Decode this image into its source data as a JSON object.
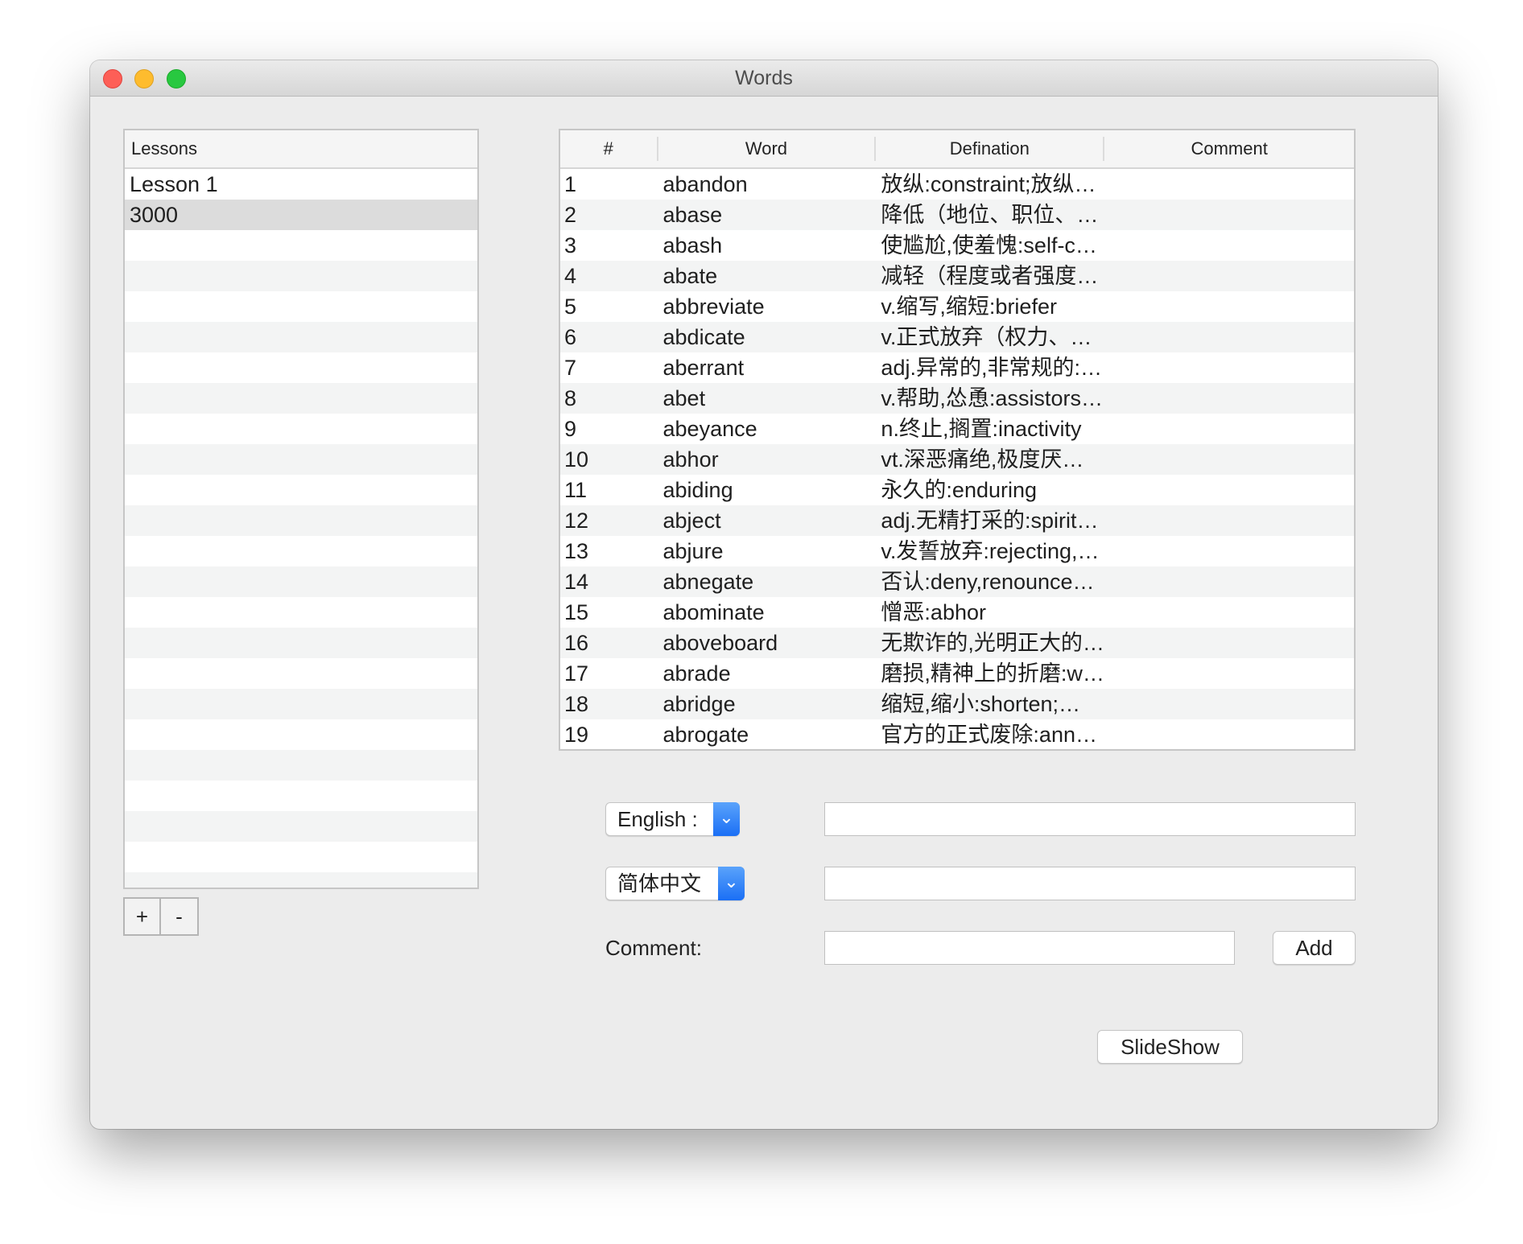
{
  "window": {
    "title": "Words"
  },
  "lessons": {
    "header": "Lessons",
    "items": [
      {
        "label": "Lesson 1",
        "selected": false
      },
      {
        "label": "3000",
        "selected": true
      }
    ],
    "add_label": "+",
    "remove_label": "-"
  },
  "table": {
    "columns": [
      "#",
      "Word",
      "Defination",
      "Comment"
    ],
    "rows": [
      {
        "num": "1",
        "word": "abandon",
        "definition": "放纵:constraint;放纵…",
        "comment": ""
      },
      {
        "num": "2",
        "word": "abase",
        "definition": "降低（地位、职位、…",
        "comment": ""
      },
      {
        "num": "3",
        "word": "abash",
        "definition": "使尴尬,使羞愧:self-c…",
        "comment": ""
      },
      {
        "num": "4",
        "word": "abate",
        "definition": "减轻（程度或者强度…",
        "comment": ""
      },
      {
        "num": "5",
        "word": "abbreviate",
        "definition": "v.缩写,缩短:briefer",
        "comment": ""
      },
      {
        "num": "6",
        "word": "abdicate",
        "definition": "v.正式放弃（权力、…",
        "comment": ""
      },
      {
        "num": "7",
        "word": "aberrant",
        "definition": "adj.异常的,非常规的:…",
        "comment": ""
      },
      {
        "num": "8",
        "word": "abet",
        "definition": "v.帮助,怂恿:assistors…",
        "comment": ""
      },
      {
        "num": "9",
        "word": "abeyance",
        "definition": "n.终止,搁置:inactivity",
        "comment": ""
      },
      {
        "num": "10",
        "word": "abhor",
        "definition": "vt.深恶痛绝,极度厌…",
        "comment": ""
      },
      {
        "num": "11",
        "word": "abiding",
        "definition": "永久的:enduring",
        "comment": ""
      },
      {
        "num": "12",
        "word": "abject",
        "definition": "adj.无精打采的:spirit…",
        "comment": ""
      },
      {
        "num": "13",
        "word": "abjure",
        "definition": "v.发誓放弃:rejecting,…",
        "comment": ""
      },
      {
        "num": "14",
        "word": "abnegate",
        "definition": "否认:deny,renounce…",
        "comment": ""
      },
      {
        "num": "15",
        "word": "abominate",
        "definition": "憎恶:abhor",
        "comment": ""
      },
      {
        "num": "16",
        "word": "aboveboard",
        "definition": "无欺诈的,光明正大的…",
        "comment": ""
      },
      {
        "num": "17",
        "word": "abrade",
        "definition": "磨损,精神上的折磨:w…",
        "comment": ""
      },
      {
        "num": "18",
        "word": "abridge",
        "definition": "缩短,缩小:shorten;…",
        "comment": ""
      },
      {
        "num": "19",
        "word": "abrogate",
        "definition": "官方的正式废除:ann…",
        "comment": ""
      }
    ]
  },
  "form": {
    "lang1_selected": "English :",
    "lang1_value": "",
    "lang2_selected": "简体中文",
    "lang2_value": "",
    "comment_label": "Comment:",
    "comment_value": "",
    "add_label": "Add",
    "slideshow_label": "SlideShow"
  },
  "colors": {
    "window_bg": "#ececec",
    "accent_blue": "#1b6ff5",
    "close": "#fd5f57",
    "minimize": "#febc2e",
    "maximize": "#28c840"
  }
}
